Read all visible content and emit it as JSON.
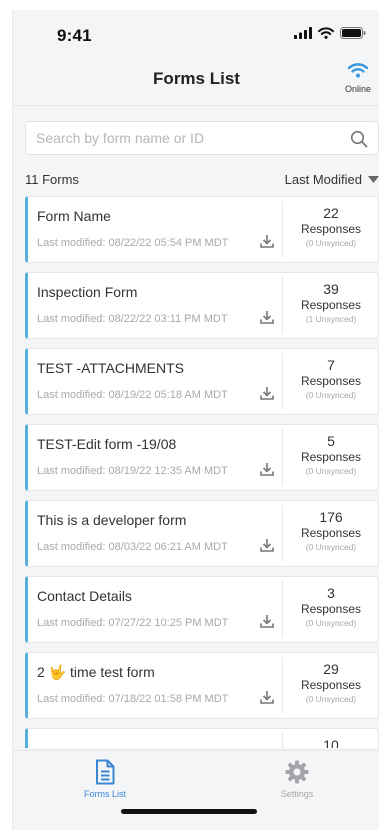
{
  "status_bar": {
    "time": "9:41"
  },
  "header": {
    "title": "Forms List",
    "connection_label": "Online"
  },
  "search": {
    "placeholder": "Search by form name or ID"
  },
  "list_header": {
    "count_label": "11 Forms",
    "sort_label": "Last Modified"
  },
  "forms": [
    {
      "name": "Form Name",
      "modified": "Last modified: 08/22/22 05:54 PM MDT",
      "responses": "22",
      "responses_label": "Responses",
      "unsynced": "(0 Unsynced)"
    },
    {
      "name": "Inspection Form",
      "modified": "Last modified: 08/22/22 03:11 PM MDT",
      "responses": "39",
      "responses_label": "Responses",
      "unsynced": "(1 Unsynced)"
    },
    {
      "name": "TEST -ATTACHMENTS",
      "modified": "Last modified: 08/19/22 05:18 AM MDT",
      "responses": "7",
      "responses_label": "Responses",
      "unsynced": "(0 Unsynced)"
    },
    {
      "name": "TEST-Edit form -19/08",
      "modified": "Last modified: 08/19/22 12:35 AM MDT",
      "responses": "5",
      "responses_label": "Responses",
      "unsynced": "(0 Unsynced)"
    },
    {
      "name": "This is a developer form",
      "modified": "Last modified: 08/03/22 06:21 AM MDT",
      "responses": "176",
      "responses_label": "Responses",
      "unsynced": "(0 Unsynced)"
    },
    {
      "name": "Contact Details",
      "modified": "Last modified: 07/27/22 10:25 PM MDT",
      "responses": "3",
      "responses_label": "Responses",
      "unsynced": "(0 Unsynced)"
    },
    {
      "name": "2 🤟 time test form",
      "modified": "Last modified: 07/18/22 01:58 PM MDT",
      "responses": "29",
      "responses_label": "Responses",
      "unsynced": "(0 Unsynced)"
    },
    {
      "name": "",
      "modified": "",
      "responses": "10",
      "responses_label": "",
      "unsynced": ""
    }
  ],
  "tabs": [
    {
      "label": "Forms List",
      "icon": "document-icon",
      "active": true
    },
    {
      "label": "Settings",
      "icon": "gear-icon",
      "active": false
    }
  ],
  "colors": {
    "accent": "#5aaedc",
    "active_tab": "#3a86d4",
    "wifi_online": "#3a98de"
  }
}
